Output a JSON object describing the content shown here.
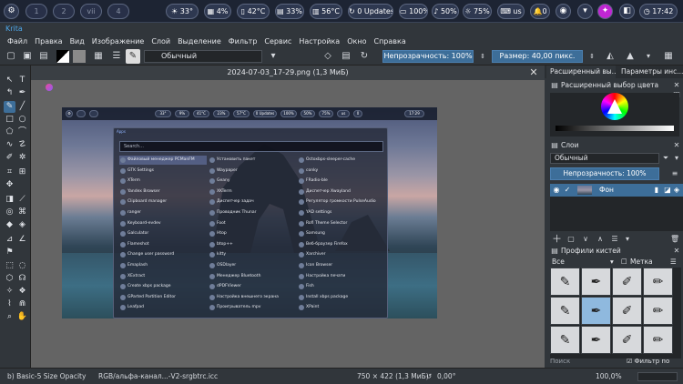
{
  "topbar": {
    "workspaces": [
      "1",
      "2",
      "3",
      "4"
    ],
    "workspace_names": [
      "",
      "",
      "vii",
      ""
    ],
    "weather": "33°",
    "cpu": "4%",
    "temp": "42°C",
    "memory": "33%",
    "gpu_temp": "56°C",
    "updates": "0 Updates",
    "battery": "100%",
    "volume": "50%",
    "brightness": "75%",
    "keyboard": "us",
    "notifications": "0",
    "time": "17:42"
  },
  "window": {
    "title": "Krita"
  },
  "menu": [
    "Файл",
    "Правка",
    "Вид",
    "Изображение",
    "Слой",
    "Выделение",
    "Фильтр",
    "Сервис",
    "Настройка",
    "Окно",
    "Справка"
  ],
  "toolbar": {
    "brush_preset": "Обычный",
    "opacity": "Непрозрачность: 100%",
    "size": "Размер: 40,00 пикс."
  },
  "document": {
    "tab_title": "2024-07-03_17-29.png (1,3 МиБ)"
  },
  "screenshot_inner": {
    "bar_pills": [
      "33°",
      "9%",
      "41°C",
      "23%",
      "57°C",
      "0 Updates",
      "100%",
      "50%",
      "75%",
      "us",
      "0",
      "17:29"
    ],
    "launcher_title": "Apps",
    "search_placeholder": "Search...",
    "apps": [
      [
        "Файловый менеджер PCManFM",
        "Установить пакет",
        "Octoxbps-sleeper-cache"
      ],
      [
        "GTK Settings",
        "Waypaper",
        "conky"
      ],
      [
        "XTerm",
        "Geany",
        "FRadio-ble"
      ],
      [
        "Yandex Browser",
        "XKTerm",
        "Диспетчер Xwayland"
      ],
      [
        "Clipboard manager",
        "Диспетчер задач",
        "Регулятор громкости PulseAudio"
      ],
      [
        "ranger",
        "Проводник Thunar",
        "YAD settings"
      ],
      [
        "Keyboard-evdev",
        "Foot",
        "Rofi Theme Selector"
      ],
      [
        "Galculator",
        "Htop",
        "Samsung"
      ],
      [
        "Flameshot",
        "btop++",
        "Веб-браузер Firefox"
      ],
      [
        "Change user password",
        "kitty",
        "Xarchiver"
      ],
      [
        "Emaplash",
        "OSDlayer",
        "Icon Browser"
      ],
      [
        "XExtract",
        "Менеджер Bluetooth",
        "Настройка печати"
      ],
      [
        "Create xbps package",
        "dPDFViewer",
        "Fish"
      ],
      [
        "GParted Partition Editor",
        "Настройка внешнего экрана",
        "Install xbps package"
      ],
      [
        "Leafpad",
        "Проигрыватель mpv",
        "XPaint"
      ]
    ]
  },
  "docker": {
    "tabs": [
      "Расширенный вы...",
      "Параметры инс..."
    ],
    "color_selector_title": "Расширенный выбор цвета",
    "layers_title": "Слои",
    "blend_mode": "Обычный",
    "layer_opacity": "Непрозрачность:  100%",
    "layer_name": "Фон",
    "brush_presets_title": "Профили кистей",
    "brush_filter": "Все",
    "brush_tag": "Метка",
    "search_placeholder": "Поиск",
    "filter_by_tag": "Фильтр по метке"
  },
  "status": {
    "brush": "b) Basic-5 Size Opacity",
    "color_space": "RGB/альфа-канал...-V2-srgbtrc.icc",
    "dimensions": "750 × 422 (1,3 МиБ)",
    "rotation": "0,00°",
    "zoom": "100,0%"
  },
  "colors": {
    "accent": "#3d6e99",
    "panel": "#31363b",
    "topbar": "#1d2433",
    "title": "#4ea6e8"
  }
}
